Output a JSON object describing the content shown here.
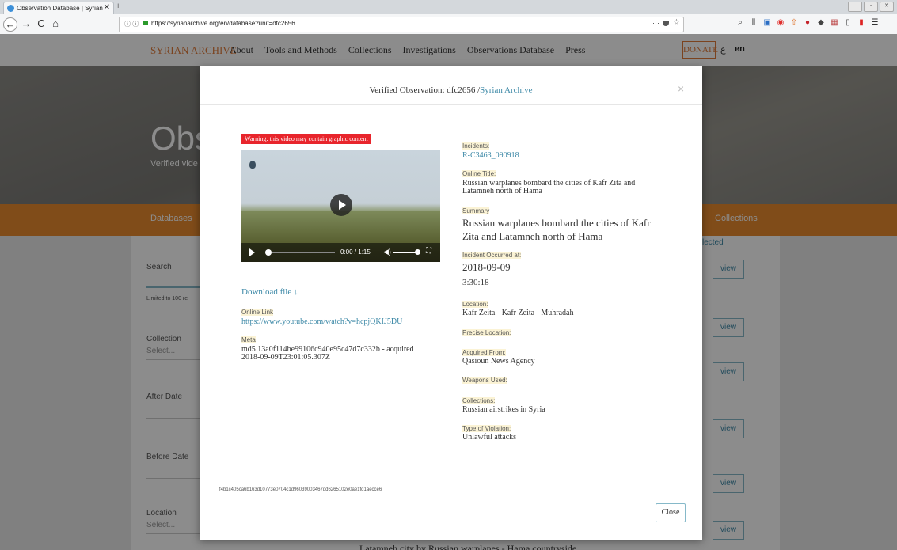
{
  "browser": {
    "tab_title": "Observation Database | Syrian ",
    "tab_close": "✕",
    "new_tab": "+",
    "url": "https://syrianarchive.org/en/database?unit=dfc2656",
    "info_glyph": "ⓘ ⓘ",
    "page_actions": "···",
    "star": "☆",
    "nav": {
      "back": "←",
      "forward": "→",
      "reload": "C",
      "home": "⌂"
    },
    "window_controls": [
      "–",
      "▫",
      "✕"
    ],
    "toolbar_icons": [
      "search-icon",
      "library-icon",
      "extension-icon",
      "pocket-icon",
      "addon-icon",
      "ublock-icon",
      "bird-icon",
      "flag-icon",
      "sidebar-icon",
      "red-icon",
      "menu-icon"
    ],
    "toolbar_glyphs": [
      "⌕",
      "⫴",
      "▣",
      "◉",
      "⇧",
      "●",
      "◆",
      "▦",
      "▯",
      "▮",
      "☰"
    ]
  },
  "site": {
    "brand": "SYRIAN ARCHIVE",
    "menu": [
      "About",
      "Tools and Methods",
      "Collections",
      "Investigations",
      "Observations Database",
      "Press"
    ],
    "donate": "DONATE",
    "lang_alt": "ع",
    "lang": "en",
    "hero_title": "Obs",
    "hero_sub": "Verified vide",
    "bar_left": "Databases",
    "bar_right": "Collections",
    "selected": "lected",
    "sidebar": [
      {
        "label": "Search",
        "placeholder": ""
      },
      {
        "label": "Limited to 100 re",
        "placeholder": ""
      },
      {
        "label": "Collection",
        "placeholder": "Select..."
      },
      {
        "label": "After Date",
        "placeholder": ""
      },
      {
        "label": "Before Date",
        "placeholder": ""
      },
      {
        "label": "Location",
        "placeholder": "Select..."
      }
    ],
    "view_label": "view",
    "bottom_text": "Latamneh city by Russian warplanes - Hama countryside"
  },
  "modal": {
    "title_prefix": "Verified Observation: dfc2656 /",
    "title_link": "Syrian Archive",
    "close_x": "×",
    "warning": "Warning: this video may contain graphic content",
    "video_time": "0:00 / 1:15",
    "video_progress": 0.0,
    "download": "Download file ↓",
    "online_link_label": "Online Link",
    "online_link": "https://www.youtube.com/watch?v=hcpjQKIJ5DU",
    "meta_label": "Meta",
    "meta_value_1": "md5 13a0f114be99106c940e95c47d7c332b - acquired",
    "meta_value_2": "2018-09-09T23:01:05.307Z",
    "incidents_label": "Incidents:",
    "incidents_value": "R-C3463_090918",
    "online_title_label": "Online Title:",
    "online_title_1": "Russian warplanes bombard the cities of Kafr Zita and",
    "online_title_2": "Latamneh north of Hama",
    "summary_label": "Summary",
    "summary_1": "Russian warplanes bombard the cities of Kafr",
    "summary_2": "Zita and Latamneh north of Hama",
    "occurred_label": "Incident Occurred at:",
    "occurred_date": "2018-09-09",
    "occurred_time": "3:30:18",
    "location_label": "Location:",
    "location_value": "Kafr Zeita - Kafr Zeita - Muhradah",
    "precise_label": "Precise Location:",
    "acquired_label": "Acquired From:",
    "acquired_value": "Qasioun News Agency",
    "weapons_label": "Weapons Used:",
    "collections_label": "Collections:",
    "collections_value": "Russian airstrikes in Syria",
    "violation_label": "Type of Violation:",
    "violation_value": "Unlawful attacks",
    "hash": "f4b1c405ca6b163d10773e0704c1d96039003467dd6265102e0ae1fd1aecce6",
    "close_button": "Close"
  }
}
